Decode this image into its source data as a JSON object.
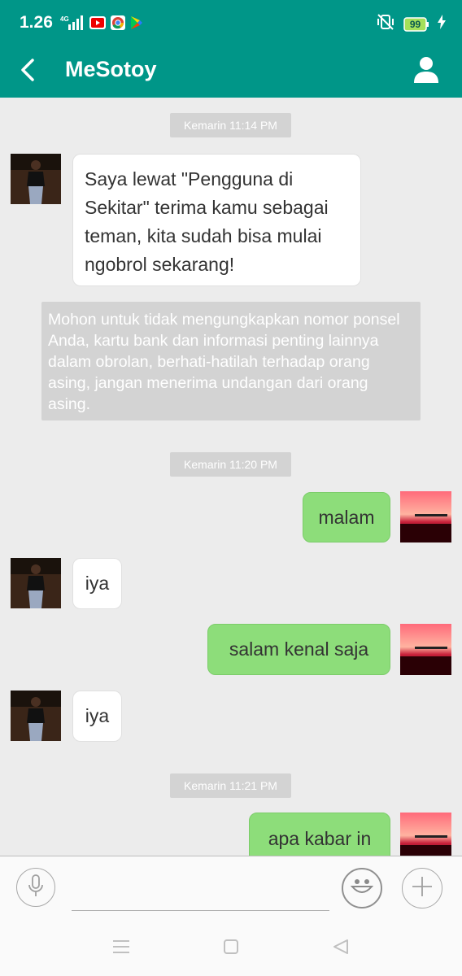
{
  "status": {
    "time": "1.26",
    "network": "4G",
    "battery": "99"
  },
  "header": {
    "title": "MeSotoy",
    "back_icon": "chevron-left-icon",
    "profile_icon": "person-icon"
  },
  "chat": {
    "timestamps": [
      "Kemarin 11:14 PM",
      "Kemarin 11:20 PM",
      "Kemarin 11:21 PM"
    ],
    "messages": [
      {
        "side": "in",
        "text": "Saya lewat \"Pengguna di Sekitar\" terima kamu sebagai teman, kita sudah bisa mulai ngobrol sekarang!"
      },
      {
        "side": "out",
        "text": "malam"
      },
      {
        "side": "in",
        "text": "iya"
      },
      {
        "side": "out",
        "text": "salam kenal saja"
      },
      {
        "side": "in",
        "text": "iya"
      },
      {
        "side": "out",
        "text": "apa kabar in"
      }
    ],
    "notice": "Mohon untuk tidak  mengungkapkan nomor ponsel Anda, kartu bank dan informasi penting lainnya dalam obrolan, berhati-hatilah terhadap orang asing, jangan menerima undangan dari orang asing."
  },
  "input": {
    "placeholder": "",
    "value": ""
  },
  "colors": {
    "accent": "#009688",
    "bubble_out": "#8ddd7a",
    "bubble_in": "#ffffff",
    "chat_bg": "#ececec"
  }
}
